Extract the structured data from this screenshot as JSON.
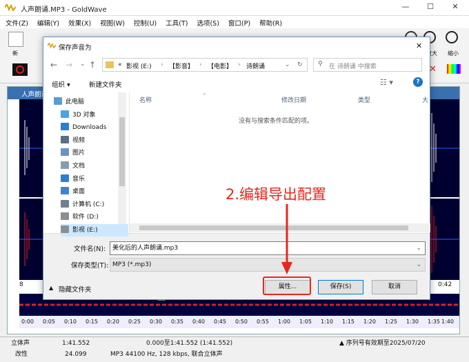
{
  "app": {
    "title": "人声朗诵.MP3 - GoldWave",
    "minimize": "—",
    "maximize": "☐",
    "close": "✕"
  },
  "menu": [
    "文件(Z)",
    "编辑(Y)",
    "效果(X)",
    "视图(W)",
    "控制(U)",
    "工具(T)",
    "选项(S)",
    "窗口(P)",
    "帮助(R)"
  ],
  "toolbar": {
    "new_label": "新",
    "zoom_in_label": "放大",
    "zoom_out_label": "缩小"
  },
  "wave_window": {
    "title": "人声朗诵",
    "start_label": "8",
    "end_label": "0:42",
    "ruler": [
      "0:00",
      "0:05",
      "0:10",
      "0:15",
      "0:20",
      "0:25",
      "0:30",
      "0:35",
      "0:40",
      "0:45",
      "0:50",
      "0:55",
      "1:00",
      "1:05",
      "1:10",
      "1:15",
      "1:20",
      "1:25",
      "1:30",
      "1:35",
      "1:40"
    ]
  },
  "status": {
    "channel": "立体声",
    "length": "1:41.552",
    "selection": "0.000至1:41.552 (1:41.552)",
    "serial": "▲ 序列号有效期至2025/07/20",
    "changed": "改性",
    "pos": "24.099",
    "format": "MP3 44100 Hz, 128 kbps, 联合立体声"
  },
  "dialog": {
    "title": "保存声音为",
    "close": "✕",
    "breadcrumb": [
      "«",
      "影视 (E:)",
      "【影音】",
      "【电影】",
      "诗朗诵"
    ],
    "search_placeholder": "在 诗朗诵 中搜索",
    "organize": "组织 ▾",
    "new_folder": "新建文件夹",
    "nav_items": [
      {
        "label": "此电脑",
        "icon": "pc-icon",
        "color": "#5b9bd5"
      },
      {
        "label": "3D 对象",
        "icon": "3d-objects-icon",
        "color": "#4aa3df"
      },
      {
        "label": "Downloads",
        "icon": "downloads-icon",
        "color": "#2a7fd4"
      },
      {
        "label": "视频",
        "icon": "videos-icon",
        "color": "#5a6f86"
      },
      {
        "label": "图片",
        "icon": "pictures-icon",
        "color": "#6a93c2"
      },
      {
        "label": "文档",
        "icon": "documents-icon",
        "color": "#8a9bb0"
      },
      {
        "label": "音乐",
        "icon": "music-icon",
        "color": "#2a7fd4"
      },
      {
        "label": "桌面",
        "icon": "desktop-icon",
        "color": "#3c86d0"
      },
      {
        "label": "计算机 (C:)",
        "icon": "drive-c-icon",
        "color": "#6e7f91"
      },
      {
        "label": "软件 (D:)",
        "icon": "drive-d-icon",
        "color": "#8a8f95"
      },
      {
        "label": "影视 (E:)",
        "icon": "drive-e-icon",
        "color": "#8a8f95"
      }
    ],
    "columns": [
      "名称",
      "修改日期",
      "类型",
      "大"
    ],
    "empty_msg": "没有与搜索条件匹配的项。",
    "filename_label": "文件名(N):",
    "filename_value": "美化后的人声朗诵.mp3",
    "filetype_label": "保存类型(T):",
    "filetype_value": "MP3 (*.mp3)",
    "hide_folders": "隐藏文件夹",
    "properties": "属性...",
    "save": "保存(S)",
    "cancel": "取消"
  },
  "annotation": "2.编辑导出配置",
  "colors": {
    "annotation": "#e8261d",
    "wave_bg": "#000030",
    "wave_left": "#ffffff",
    "wave_right": "#e82020",
    "title_bar": "#3a6fb0"
  }
}
